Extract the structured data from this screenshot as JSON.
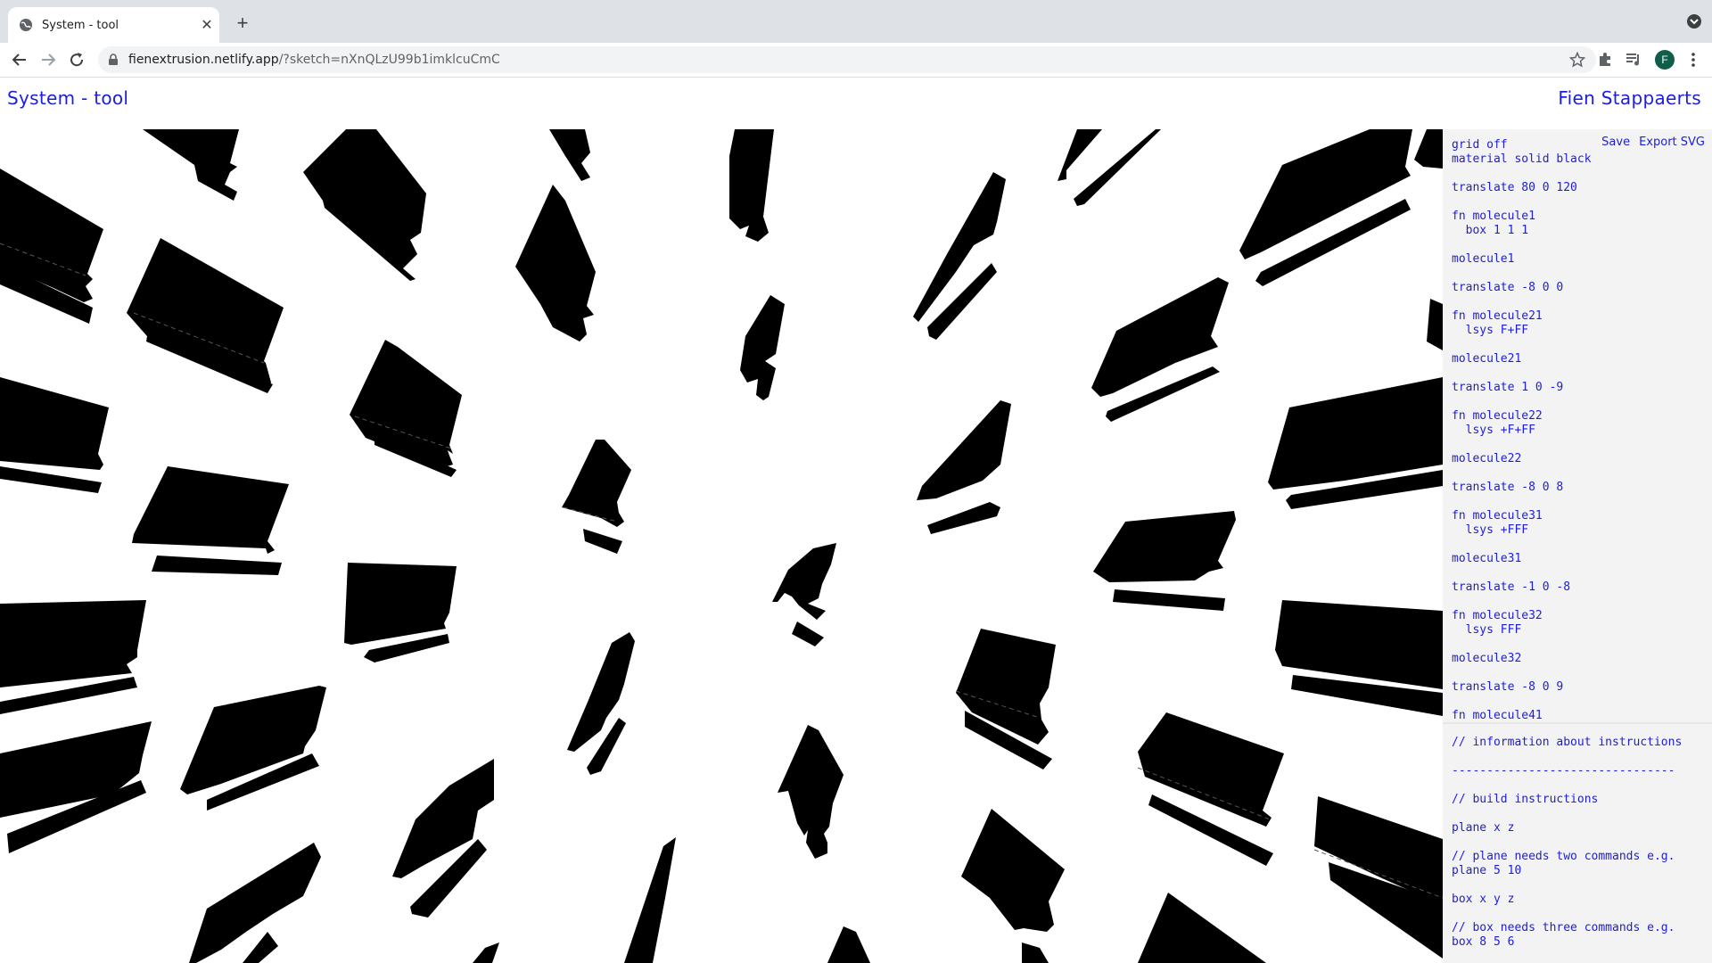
{
  "browser": {
    "tab_title": "System - tool",
    "tab_close": "✕",
    "new_tab": "+",
    "url_host": "fienextrusion.netlify.app",
    "url_path": "/?sketch=nXnQLzU99b1imklcuCmC",
    "profile_initial": "F"
  },
  "page": {
    "title": "System - tool",
    "author": "Fien Stappaerts"
  },
  "sidebar": {
    "save_label": "Save",
    "export_label": "Export SVG",
    "code": "grid off\nmaterial solid black\n\ntranslate 80 0 120\n\nfn molecule1\n  box 1 1 1\n\nmolecule1\n\ntranslate -8 0 0\n\nfn molecule21\n  lsys F+FF\n\nmolecule21\n\ntranslate 1 0 -9\n\nfn molecule22\n  lsys +F+FF\n\nmolecule22\n\ntranslate -8 0 8\n\nfn molecule31\n  lsys +FFF\n\nmolecule31\n\ntranslate -1 0 -8\n\nfn molecule32\n  lsys FFF\n\nmolecule32\n\ntranslate -8 0 9\n\nfn molecule41",
    "info": "// information about instructions\n\n--------------------------------\n\n// build instructions\n\nplane x z\n\n// plane needs two commands e.g.\nplane 5 10\n\nbox x y z\n\n// box needs three commands e.g.\nbox 8 5 6"
  },
  "colors": {
    "accent": "#1d1ddd",
    "shape_fill": "#000000",
    "sidebar_bg": "#f3f3f3",
    "chrome_bg": "#dee1e6"
  },
  "icons": [
    "globe-icon",
    "close-icon",
    "plus-icon",
    "back-icon",
    "forward-icon",
    "reload-icon",
    "lock-icon",
    "star-icon",
    "puzzle-icon",
    "media-icon",
    "kebab-icon",
    "tab-search-icon"
  ]
}
